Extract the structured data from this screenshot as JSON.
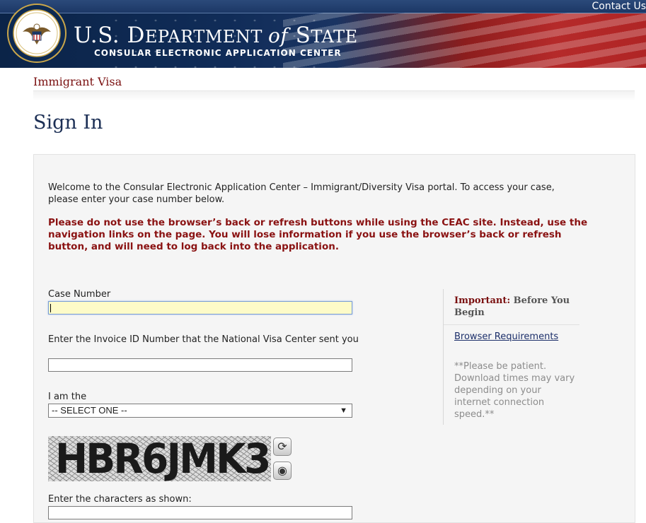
{
  "header": {
    "contact_link": "Contact Us",
    "title_us": "U.S. D",
    "title_dept": "EPARTMENT ",
    "title_of": "of",
    "title_s": " S",
    "title_state": "TATE",
    "subtitle": "CONSULAR ELECTRONIC APPLICATION CENTER",
    "seal_icon": "us-department-of-state-seal-icon"
  },
  "nav": {
    "app_label": "Immigrant Visa"
  },
  "page": {
    "title": "Sign In"
  },
  "form": {
    "welcome": "Welcome to the Consular Electronic Application Center – Immigrant/Diversity Visa portal. To access your case, please enter your case number below.",
    "warning": "Please do not use the browser’s back or refresh buttons while using the CEAC site. Instead, use the navigation links on the page. You will lose information if you use the browser’s back or refresh button, and will need to log back into the application.",
    "case_number_label": "Case Number",
    "case_number_value": "",
    "invoice_label": "Enter the Invoice ID Number that the National Visa Center sent you",
    "invoice_value": "",
    "role_label": "I am the",
    "role_selected": "-- SELECT ONE --",
    "captcha_text": "HBR6JMK3",
    "captcha_refresh_icon": "refresh-icon",
    "captcha_audio_icon": "audio-icon",
    "captcha_label": "Enter the characters as shown:",
    "captcha_value": ""
  },
  "sidebar": {
    "important_label": "Important:",
    "important_text": " Before You Begin",
    "browser_link": "Browser Requirements",
    "note": "**Please be patient. Download times may vary depending on your internet connection speed.**"
  },
  "colors": {
    "banner_navy": "#0b2448",
    "banner_red": "#b52a2a",
    "title_navy": "#1c2f55",
    "label_maroon": "#7a1010",
    "warning_red": "#8a1212",
    "focus_yellow": "#fdfbc8"
  }
}
